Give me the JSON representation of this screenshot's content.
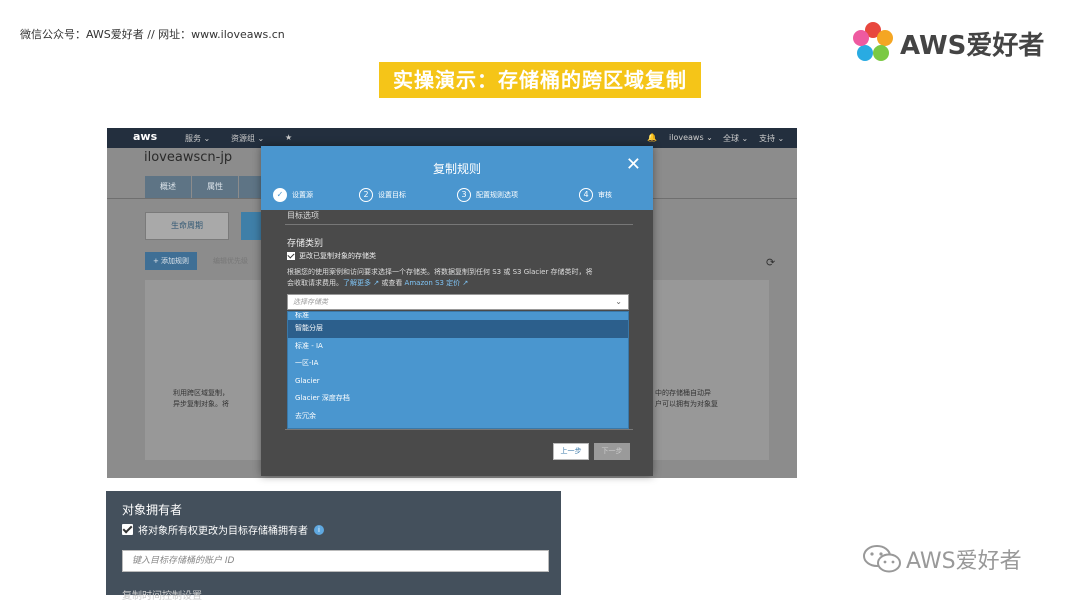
{
  "slide": {
    "header_info": "微信公众号：AWS爱好者  //  网址：www.iloveaws.cn",
    "logo_text": "AWS爱好者",
    "title": "实操演示：存储桶的跨区域复制",
    "watermark_text": "AWS爱好者"
  },
  "console": {
    "nav": {
      "logo": "aws",
      "services": "服务 ⌄",
      "resource_groups": "资源组 ⌄",
      "pin": "★",
      "bell": "🔔",
      "user": "iloveaws ⌄",
      "region": "全球 ⌄",
      "support": "支持 ⌄"
    },
    "bucket_name": "iloveawscn-jp",
    "tabs": [
      "概述",
      "属性",
      "",
      "",
      ""
    ],
    "lifecycle_button": "生命周期",
    "add_rule_button": "+ 添加规则",
    "edit_priority": "编辑优先级",
    "refresh_icon": "⟳",
    "desc_left": [
      "利用跨区域复制，",
      "异步复制对象。将"
    ],
    "desc_right": [
      "中的存储桶自动异",
      "户可以拥有为对象复"
    ]
  },
  "modal": {
    "title": "复制规则",
    "close": "✕",
    "steps": [
      {
        "num": "✓",
        "label": "设置源",
        "done": true
      },
      {
        "num": "2",
        "label": "设置目标",
        "done": false
      },
      {
        "num": "3",
        "label": "配置规则选项",
        "done": false
      },
      {
        "num": "4",
        "label": "审核",
        "done": false
      }
    ],
    "section_head": "目标选项",
    "storage_label": "存储类别",
    "checkbox_label": "更改已复制对象的存储类",
    "desc_line1": "根据您的使用案例和访问要求选择一个存储类。将数据复制到任何 S3 或 S3 Glacier 存储类时，将",
    "desc_line2_pre": "会收取请求费用。",
    "link_learn": "了解更多 ↗",
    "desc_or": " 或查看 ",
    "link_pricing": "Amazon S3 定价 ↗",
    "select_placeholder": "选择存储类",
    "select_arrow": "⌄",
    "options": [
      "标准",
      "智能分层",
      "标准 - IA",
      "一区-IA",
      "Glacier",
      "Glacier 深度存档",
      "去冗余"
    ],
    "selected_index": 1,
    "prev_button": "上一步",
    "next_button": "下一步"
  },
  "owner": {
    "title": "对象拥有者",
    "checkbox_label": "将对象所有权更改为目标存储桶拥有者",
    "info_icon": "i",
    "input_placeholder": "键入目标存储桶的账户 ID",
    "cut_text": "复制时间控制设置"
  },
  "colors": {
    "title_bg": "#f5c518",
    "modal_header": "#4a96cf",
    "dropdown_bg": "#4a96cf",
    "dropdown_selected": "#2c5f8c",
    "owner_bg": "#44505c"
  }
}
